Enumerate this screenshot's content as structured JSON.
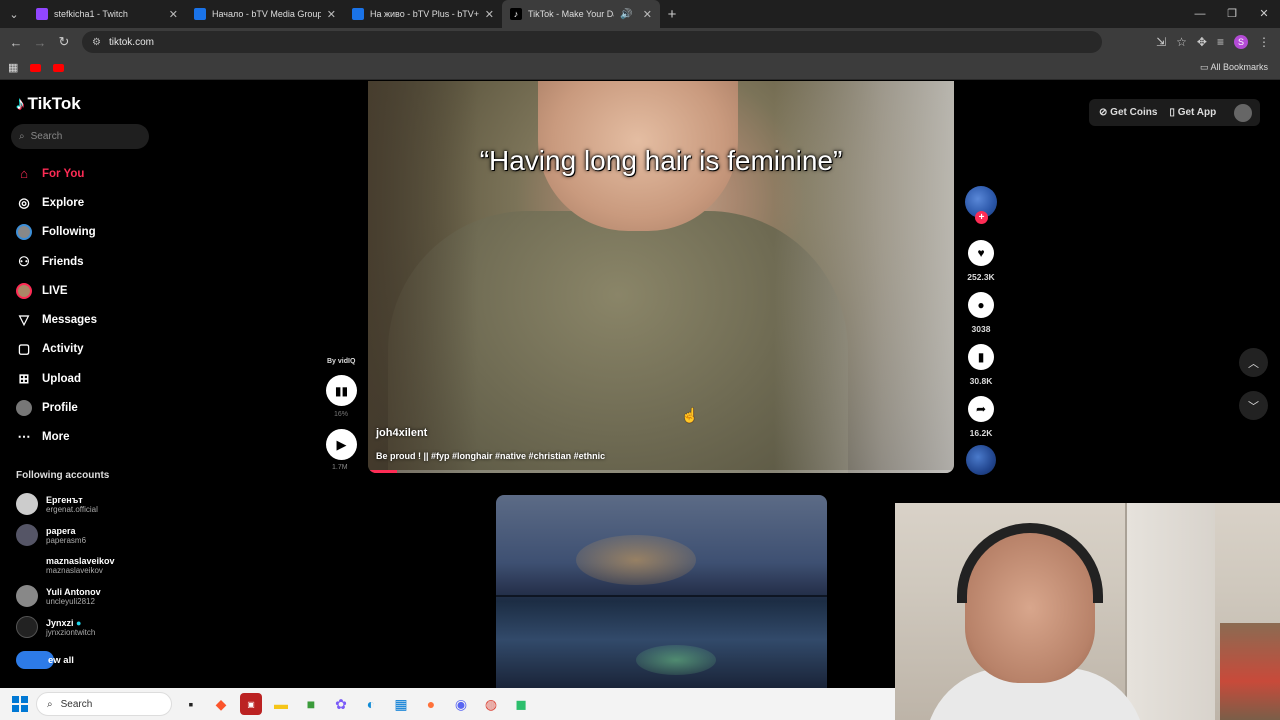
{
  "browser": {
    "tabs": [
      {
        "title": "stefkicha1 - Twitch",
        "color": "#9146ff",
        "active": false
      },
      {
        "title": "Начало - bTV Media Group - b",
        "color": "#1a73e8",
        "active": false
      },
      {
        "title": "На живо - bTV Plus - bTV+",
        "color": "#1a73e8",
        "active": false
      },
      {
        "title": "TikTok - Make Your Day",
        "color": "#000000",
        "active": true
      }
    ],
    "url": "tiktok.com",
    "profile_initial": "S",
    "all_bookmarks": "All Bookmarks"
  },
  "tiktok": {
    "logo": "TikTok",
    "search_placeholder": "Search",
    "nav": [
      {
        "label": "For You",
        "icon": "home-icon",
        "active": true
      },
      {
        "label": "Explore",
        "icon": "compass-icon",
        "active": false
      },
      {
        "label": "Following",
        "icon": "following-avatar-icon",
        "active": false
      },
      {
        "label": "Friends",
        "icon": "friends-icon",
        "active": false
      },
      {
        "label": "LIVE",
        "icon": "live-icon",
        "active": false
      },
      {
        "label": "Messages",
        "icon": "messages-icon",
        "active": false
      },
      {
        "label": "Activity",
        "icon": "activity-icon",
        "active": false
      },
      {
        "label": "Upload",
        "icon": "upload-icon",
        "active": false
      },
      {
        "label": "Profile",
        "icon": "profile-icon",
        "active": false
      },
      {
        "label": "More",
        "icon": "more-icon",
        "active": false
      }
    ],
    "following_title": "Following accounts",
    "accounts": [
      {
        "name": "Ергенът",
        "username": "ergenat.official"
      },
      {
        "name": "papera",
        "username": "paperasm6"
      },
      {
        "name": "maznaslaveikov",
        "username": "maznaslaveikov"
      },
      {
        "name": "Yuli Antonov",
        "username": "uncleyuli2812"
      },
      {
        "name": "Jynxzi",
        "username": "jynxziontwitch"
      }
    ],
    "see_all": "ew all",
    "top_right": {
      "coins": "Get Coins",
      "app": "Get App"
    },
    "video": {
      "overlay_text": "“Having long hair is feminine”",
      "author": "joh4xilent",
      "description": "Be proud ! || #fyp #longhair #native #christian #ethnic",
      "progress": 0.05
    },
    "vidiq": {
      "by": "By vidIQ",
      "pct": "16%",
      "views": "1.7M"
    },
    "actions": {
      "likes": "252.3K",
      "comments": "3038",
      "saves": "30.8K",
      "shares": "16.2K"
    }
  },
  "taskbar": {
    "search_label": "Search"
  }
}
